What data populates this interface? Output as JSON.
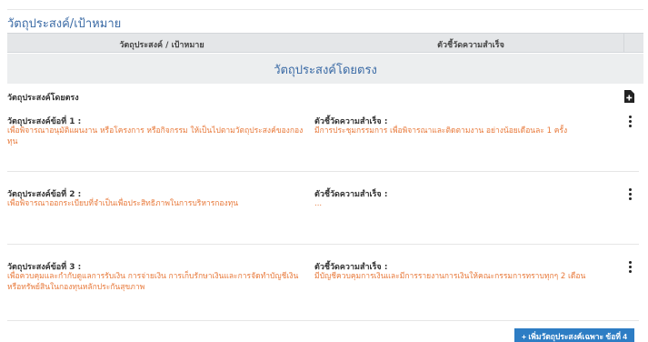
{
  "section": {
    "title": "วัตถุประสงค์/เป้าหมาย"
  },
  "table_header": {
    "objective": "วัตถุประสงค์ / เป้าหมาย",
    "kpi": "ตัวชี้วัดความสำเร็จ"
  },
  "group": {
    "title": "วัตถุประสงค์โดยตรง",
    "label": "วัตถุประสงค์โดยตรง"
  },
  "items": [
    {
      "objective_label": "วัตถุประสงค์ข้อที่ 1 :",
      "objective_text": "เพื่อพิจารณาอนุมัติแผนงาน หรือโครงการ หรือกิจกรรม ให้เป็นไปตามวัตถุประสงค์ของกองทุน",
      "kpi_label": "ตัวชี้วัดความสำเร็จ :",
      "kpi_text": "มีการประชุมกรรมการ เพื่อพิจารณาและติดตามงาน อย่างน้อยเดือนละ 1 ครั้ง"
    },
    {
      "objective_label": "วัตถุประสงค์ข้อที่ 2 :",
      "objective_text": "เพื่อพิจารณาออกระเบียบที่จำเป็นเพื่อประสิทธิภาพในการบริหารกองทุน",
      "kpi_label": "ตัวชี้วัดความสำเร็จ :",
      "kpi_text": "..."
    },
    {
      "objective_label": "วัตถุประสงค์ข้อที่ 3 :",
      "objective_text": "เพื่อควบคุมและกำกับดูแลการรับเงิน การจ่ายเงิน การเก็บรักษาเงินและการจัดทำบัญชีเงินหรือทรัพย์สินในกองทุนหลักประกันสุขภาพ",
      "kpi_label": "ตัวชี้วัดความสำเร็จ :",
      "kpi_text": "มีบัญชีควบคุมการเงินและมีการรายงานการเงินให้คณะกรรมการทราบทุกๆ 2 เดือน"
    }
  ],
  "actions": {
    "add_label": "+ เพิ่มวัตถุประสงค์เฉพาะ ข้อที่ 4"
  },
  "icons": {
    "add_doc": "add-document-icon",
    "menu": "vertical-ellipsis-icon"
  },
  "colors": {
    "accent_blue": "#3a6aa5",
    "orange_text": "#e8793a",
    "button_blue": "#2d7dc4"
  }
}
